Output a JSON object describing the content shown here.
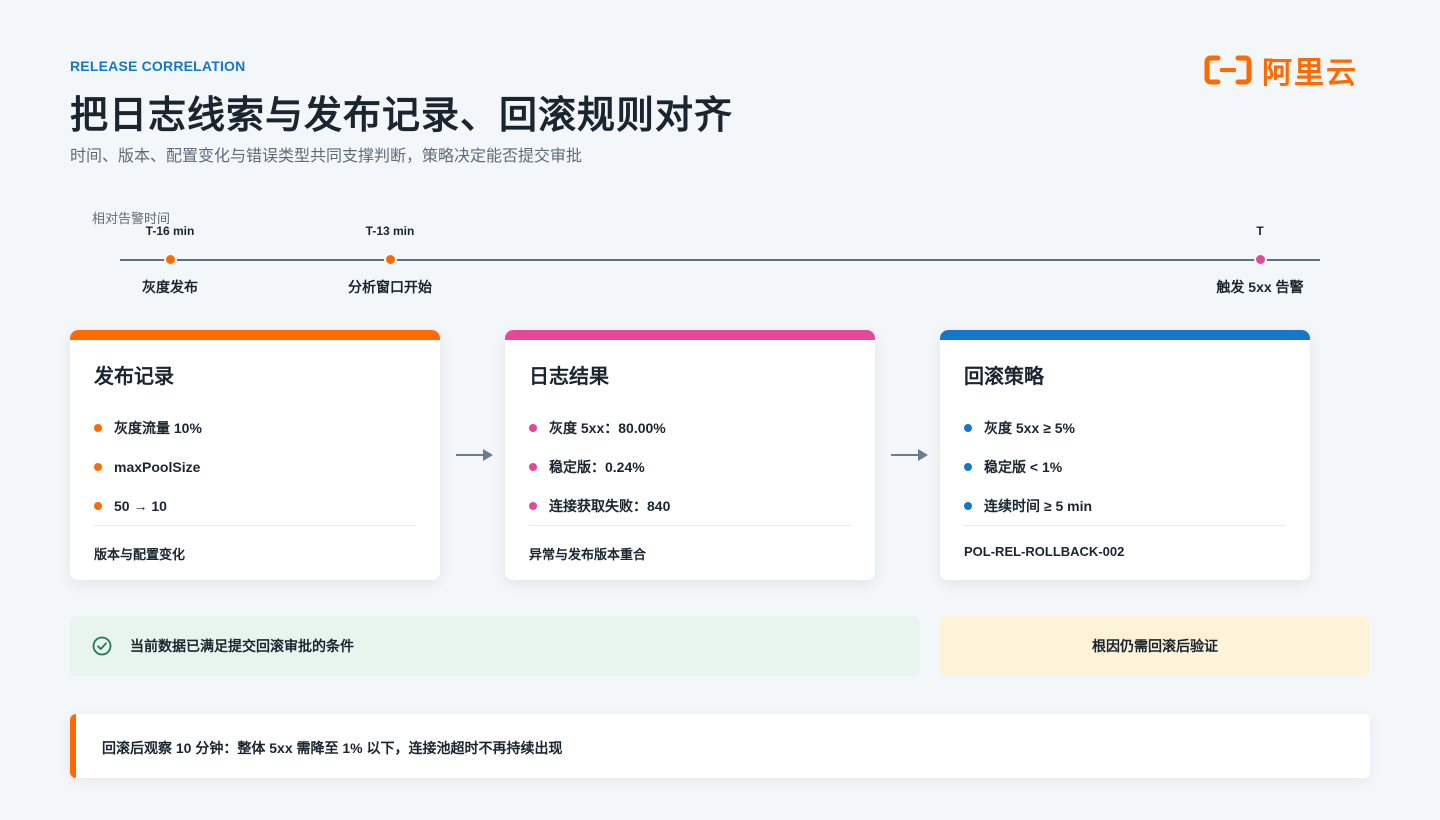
{
  "header": {
    "eyebrow": "RELEASE CORRELATION",
    "title": "把日志线索与发布记录、回滚规则对齐",
    "subtitle": "时间、版本、配置变化与错误类型共同支撑判断，策略决定能否提交审批"
  },
  "logo": {
    "text": "阿里云",
    "color": "#ff6a00",
    "icon": "aliyun-bracket-logo-icon"
  },
  "timeline": {
    "caption": "相对告警时间",
    "points": [
      {
        "time": "T-16 min",
        "label": "灰度发布",
        "color": "#ff6a00"
      },
      {
        "time": "T-13 min",
        "label": "分析窗口开始",
        "color": "#ff6a00"
      },
      {
        "time": "T",
        "label": "触发 5xx 告警",
        "color": "#e5489a"
      }
    ]
  },
  "cards": [
    {
      "title": "发布记录",
      "color": "#ff6a00",
      "items": [
        "灰度流量 10%",
        "maxPoolSize",
        "50 → 10"
      ],
      "footer": "版本与配置变化"
    },
    {
      "title": "日志结果",
      "color": "#e5489a",
      "items": [
        "灰度 5xx：80.00%",
        "稳定版：0.24%",
        "连接获取失败：840"
      ],
      "footer": "异常与发布版本重合"
    },
    {
      "title": "回滚策略",
      "color": "#1677c8",
      "items": [
        "灰度 5xx ≥ 5%",
        "稳定版 < 1%",
        "连续时间 ≥ 5 min"
      ],
      "footer": "POL-REL-ROLLBACK-002"
    }
  ],
  "status": {
    "ok_text": "当前数据已满足提交回滚审批的条件",
    "ok_icon": "check-circle-icon",
    "warn_text": "根因仍需回滚后验证"
  },
  "note": {
    "text": "回滚后观察 10 分钟：整体 5xx 需降至 1% 以下，连接池超时不再持续出现"
  }
}
